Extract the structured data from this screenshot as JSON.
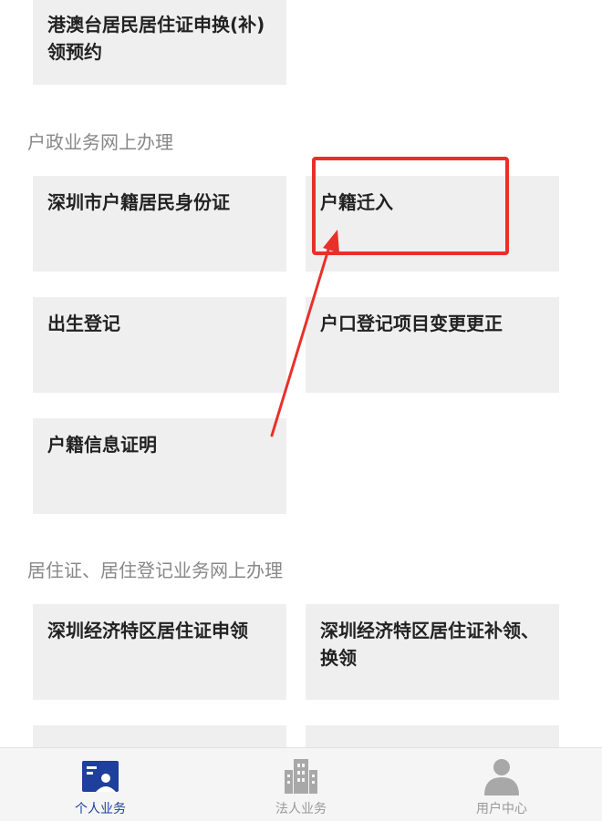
{
  "top_card": {
    "label": "港澳台居民居住证申换(补)领预约"
  },
  "sections": [
    {
      "title": "户政业务网上办理",
      "cards": [
        "深圳市户籍居民身份证",
        "户籍迁入",
        "出生登记",
        "户口登记项目变更更正",
        "户籍信息证明"
      ]
    },
    {
      "title": "居住证、居住登记业务网上办理",
      "cards": [
        "深圳经济特区居住证申领",
        "深圳经济特区居住证补领、换领"
      ]
    }
  ],
  "tabbar": {
    "active_color": "#1e3f9c",
    "inactive_color": "#999999",
    "tabs": [
      {
        "label": "个人业务",
        "icon": "id-card-icon",
        "active": true
      },
      {
        "label": "法人业务",
        "icon": "building-icon",
        "active": false
      },
      {
        "label": "用户中心",
        "icon": "user-icon",
        "active": false
      }
    ]
  },
  "annotation": {
    "color": "#e8302a"
  }
}
